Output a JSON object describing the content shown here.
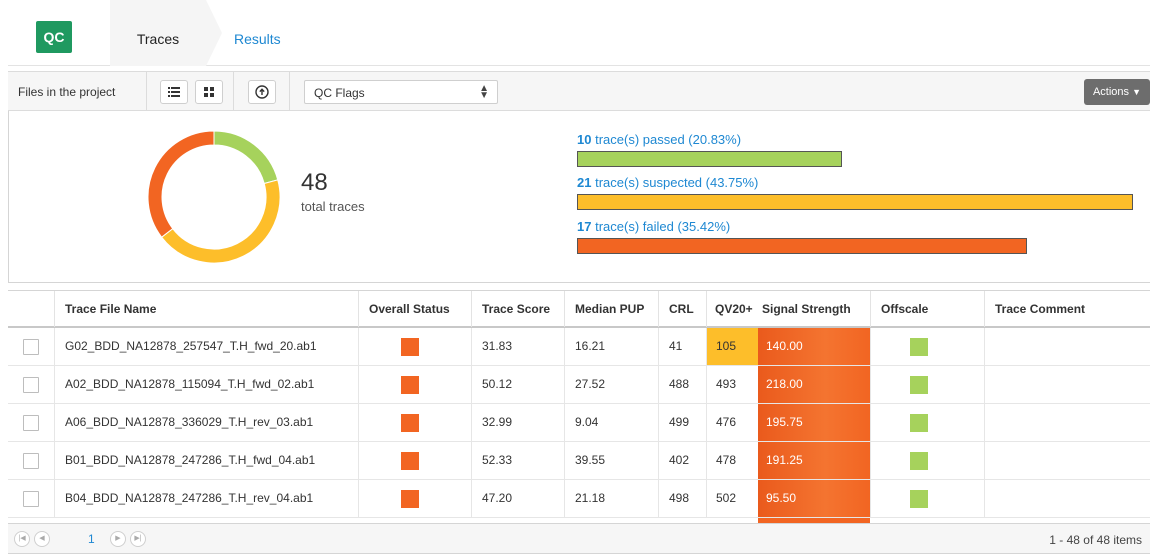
{
  "header": {
    "logo": "QC",
    "tabs": [
      {
        "label": "Traces",
        "active": true
      },
      {
        "label": "Results",
        "active": false
      }
    ]
  },
  "toolbar": {
    "files_label": "Files in the project",
    "list_view_icon": "list-view-icon",
    "grid_view_icon": "grid-view-icon",
    "upload_icon": "upload-icon",
    "select_value": "QC Flags",
    "actions_label": "Actions"
  },
  "summary": {
    "total_number": "48",
    "total_label": "total traces",
    "stats": [
      {
        "count": "10",
        "text": "trace(s) passed (20.83%)",
        "percent": 20.83,
        "color": "#a6d25c"
      },
      {
        "count": "21",
        "text": "trace(s) suspected (43.75%)",
        "percent": 43.75,
        "color": "#fdbe2a"
      },
      {
        "count": "17",
        "text": "trace(s) failed (35.42%)",
        "percent": 35.42,
        "color": "#f26522"
      }
    ]
  },
  "table": {
    "columns": [
      "Trace File Name",
      "Overall Status",
      "Trace Score",
      "Median PUP",
      "CRL",
      "QV20+",
      "Signal Strength",
      "Offscale",
      "Trace Comment"
    ],
    "rows": [
      {
        "name": "G02_BDD_NA12878_257547_T.H_fwd_20.ab1",
        "score": "31.83",
        "pup": "16.21",
        "crl": "41",
        "qv20": "105",
        "qv_highlight": true,
        "signal": "140.00"
      },
      {
        "name": "A02_BDD_NA12878_115094_T.H_fwd_02.ab1",
        "score": "50.12",
        "pup": "27.52",
        "crl": "488",
        "qv20": "493",
        "qv_highlight": false,
        "signal": "218.00"
      },
      {
        "name": "A06_BDD_NA12878_336029_T.H_rev_03.ab1",
        "score": "32.99",
        "pup": "9.04",
        "crl": "499",
        "qv20": "476",
        "qv_highlight": false,
        "signal": "195.75"
      },
      {
        "name": "B01_BDD_NA12878_247286_T.H_fwd_04.ab1",
        "score": "52.33",
        "pup": "39.55",
        "crl": "402",
        "qv20": "478",
        "qv_highlight": false,
        "signal": "191.25"
      },
      {
        "name": "B04_BDD_NA12878_247286_T.H_rev_04.ab1",
        "score": "47.20",
        "pup": "21.18",
        "crl": "498",
        "qv20": "502",
        "qv_highlight": false,
        "signal": "95.50"
      }
    ]
  },
  "pagination": {
    "current_page": "1",
    "info": "1 - 48 of 48 items"
  },
  "colors": {
    "passed": "#a6d25c",
    "suspected": "#fdbe2a",
    "failed": "#f26522",
    "link": "#1e88d2",
    "logo": "#1f9960"
  }
}
